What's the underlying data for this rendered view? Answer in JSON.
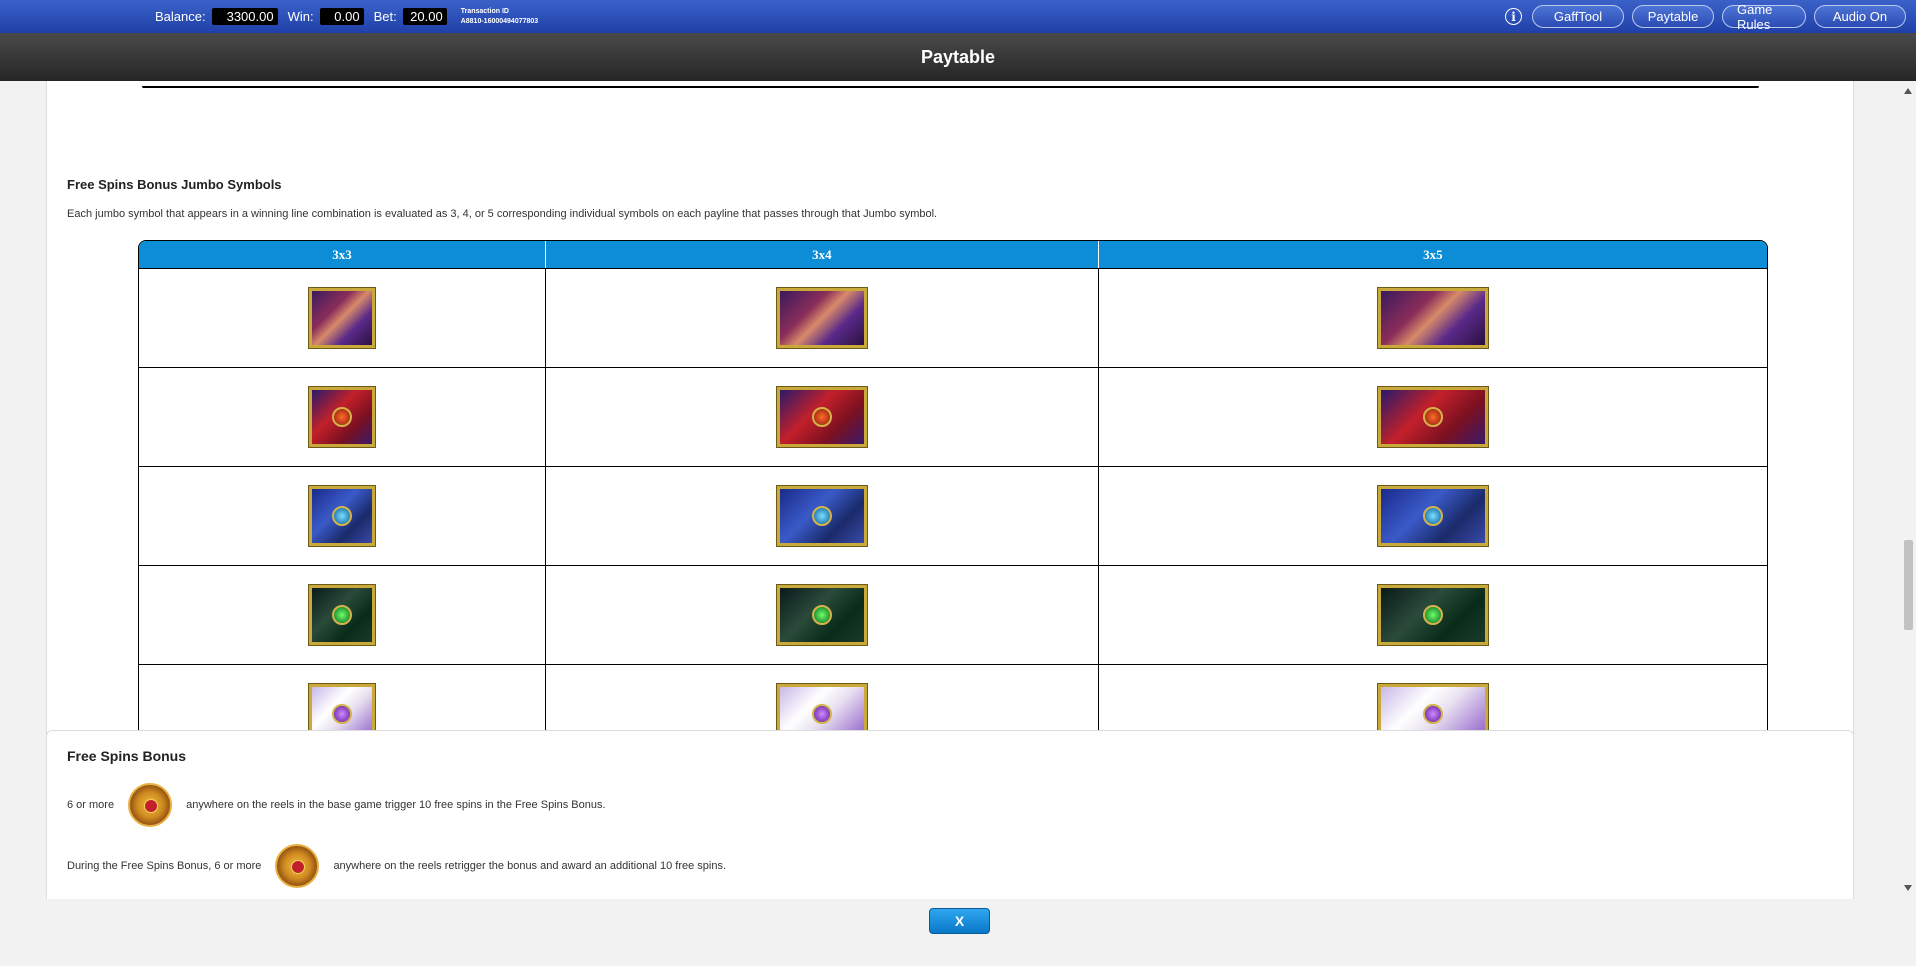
{
  "topbar": {
    "balance_label": "Balance:",
    "balance_value": "3300.00",
    "win_label": "Win:",
    "win_value": "0.00",
    "bet_label": "Bet:",
    "bet_value": "20.00",
    "transaction_label": "Transaction ID",
    "transaction_value": "A8810-16000494077803",
    "info_icon": "i",
    "buttons": [
      {
        "label": "GaffTool"
      },
      {
        "label": "Paytable"
      },
      {
        "label": "Game Rules"
      },
      {
        "label": "Audio On"
      }
    ]
  },
  "title": "Paytable",
  "jumbo_section": {
    "title": "Free Spins Bonus Jumbo Symbols",
    "description": "Each jumbo symbol that appears in a winning line combination is evaluated as 3, 4, or 5 corresponding individual symbols on each payline that passes through that Jumbo symbol.",
    "columns": [
      "3x3",
      "3x4",
      "3x5"
    ],
    "rows": [
      {
        "symbol": "hero-symbol-icon"
      },
      {
        "symbol": "red-gem-symbol-icon"
      },
      {
        "symbol": "blue-gem-symbol-icon"
      },
      {
        "symbol": "green-gem-symbol-icon"
      },
      {
        "symbol": "purple-gem-symbol-icon"
      }
    ]
  },
  "free_spins": {
    "title": "Free Spins Bonus",
    "line1_pre": "6 or more",
    "line1_post": "anywhere on the reels in the base game trigger 10 free spins in the Free Spins Bonus.",
    "line2_pre": "During the Free Spins Bonus, 6 or more",
    "line2_post": "anywhere on the reels retrigger the bonus and award an additional 10 free spins.",
    "icon": "scatter-symbol-icon"
  },
  "close_label": "X"
}
